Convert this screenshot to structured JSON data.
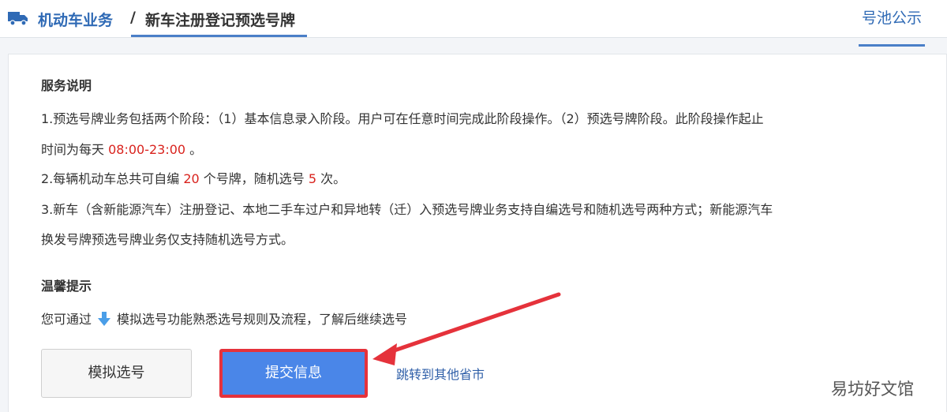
{
  "header": {
    "module": "机动车业务",
    "separator": "/",
    "page": "新车注册登记预选号牌",
    "right_tab": "号池公示"
  },
  "service": {
    "title": "服务说明",
    "line1": "1.预选号牌业务包括两个阶段：（1）基本信息录入阶段。用户可在任意时间完成此阶段操作。（2）预选号牌阶段。此阶段操作起止",
    "line2_prefix": "时间为每天 ",
    "line2_time": "08:00-23:00",
    "line2_suffix": " 。",
    "line3_a": "2.每辆机动车总共可自编 ",
    "line3_n1": "20",
    "line3_b": " 个号牌，随机选号 ",
    "line3_n2": "5",
    "line3_c": " 次。",
    "line4": "3.新车（含新能源汽车）注册登记、本地二手车过户和异地转（迁）入预选号牌业务支持自编选号和随机选号两种方式；新能源汽车",
    "line5": "换发号牌预选号牌业务仅支持随机选号方式。"
  },
  "tips": {
    "title": "温馨提示",
    "text_before": "您可通过",
    "text_after": "模拟选号功能熟悉选号规则及流程，了解后继续选号"
  },
  "buttons": {
    "simulate": "模拟选号",
    "submit": "提交信息"
  },
  "link": "跳转到其他省市",
  "watermark": "易坊好文馆",
  "colors": {
    "brand_blue": "#2f6ab5",
    "highlight_red": "#d9231e",
    "submit_blue": "#4a86e8",
    "annotation_red": "#e5323b"
  },
  "icons": {
    "module": "truck-icon",
    "tip": "arrow-down-icon"
  }
}
